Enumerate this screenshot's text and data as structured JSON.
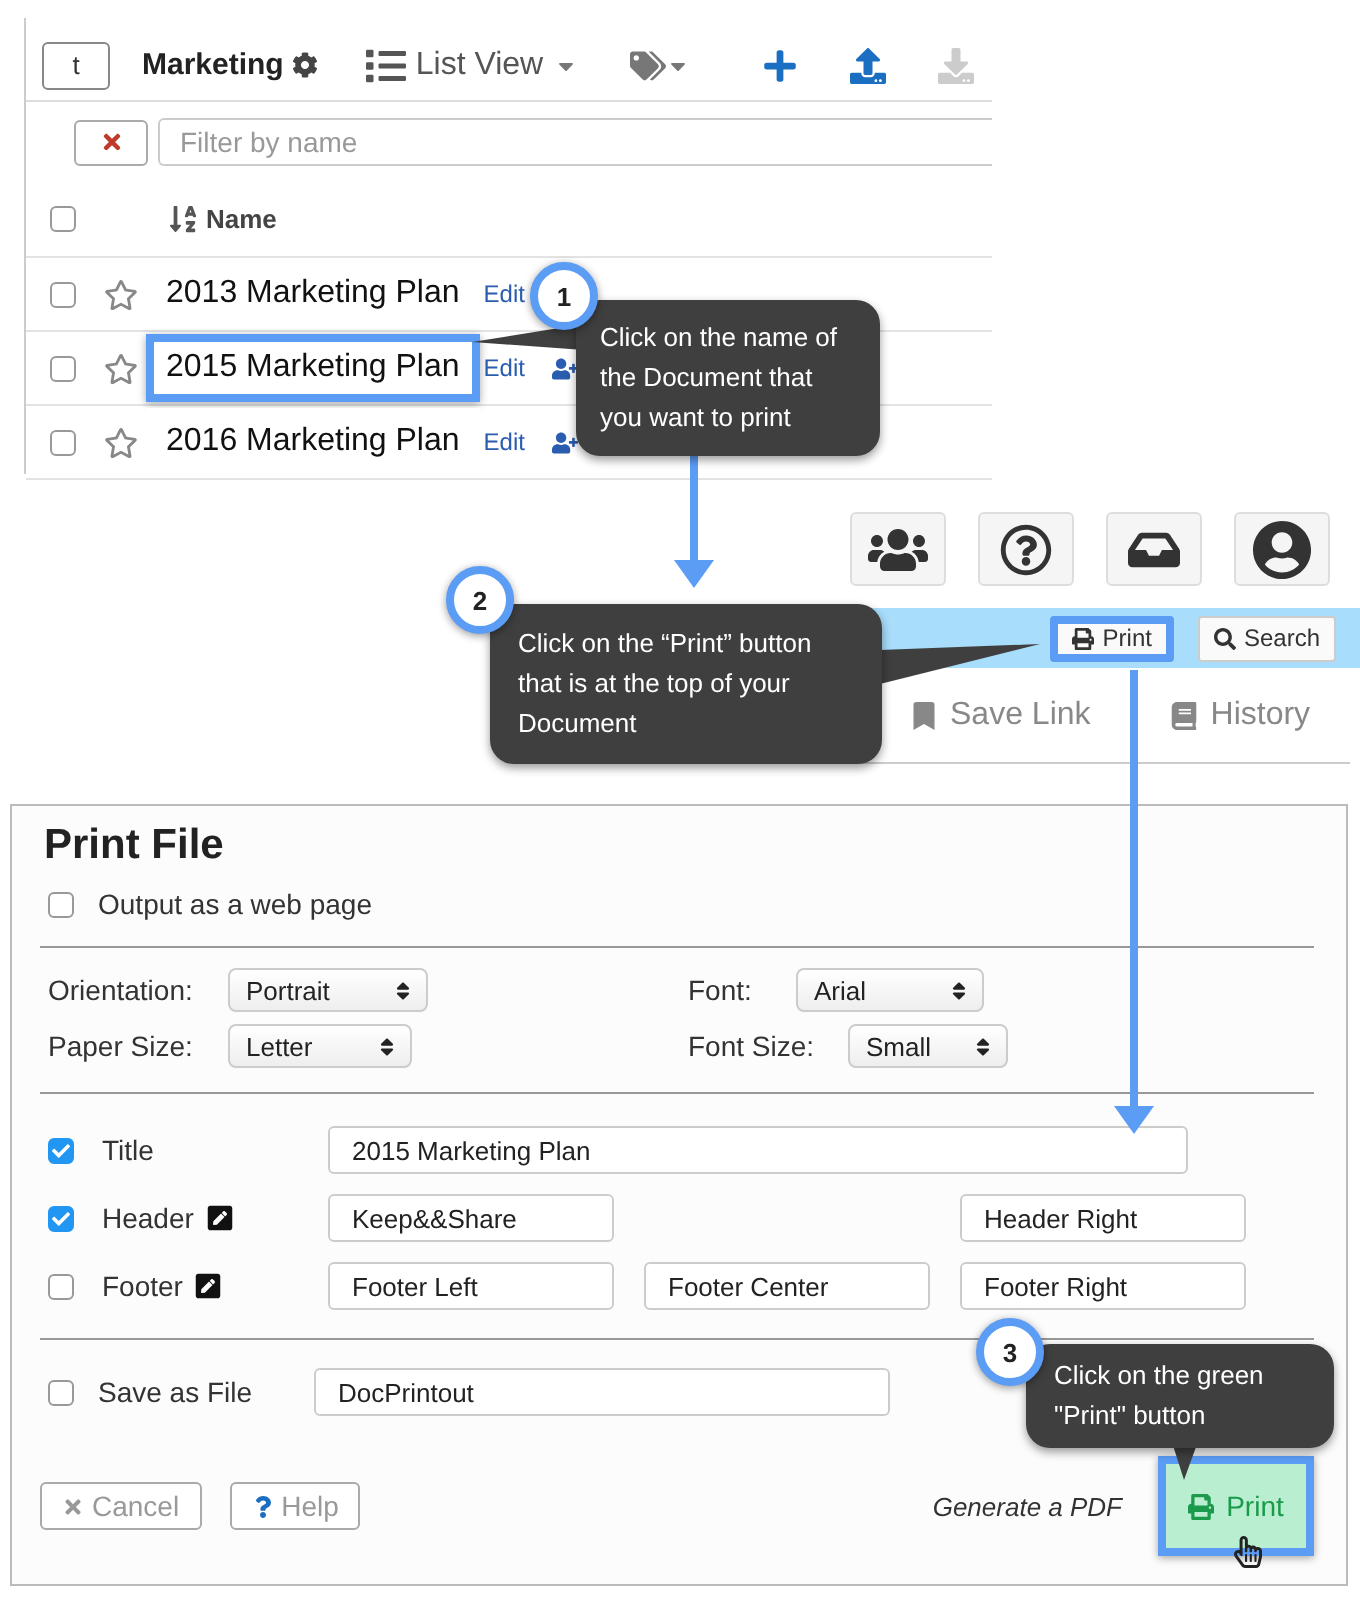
{
  "list_panel": {
    "toolbar": {
      "user_button": "t",
      "folder": "Marketing",
      "view": "List View"
    },
    "filter": {
      "placeholder": "Filter by name"
    },
    "column": "Name",
    "all_checked": false,
    "rows": [
      {
        "name": "2013 Marketing Plan",
        "action": "Edit",
        "checked": false,
        "starred": false,
        "highlighted": false
      },
      {
        "name": "2015 Marketing Plan",
        "action": "Edit",
        "checked": false,
        "starred": false,
        "highlighted": true
      },
      {
        "name": "2016 Marketing Plan",
        "action": "Edit",
        "checked": false,
        "starred": false,
        "highlighted": false
      }
    ]
  },
  "document_bar": {
    "buttons": [
      {
        "label": "Print",
        "kind": "print",
        "highlighted": true
      },
      {
        "label": "Search",
        "kind": "search",
        "highlighted": false
      }
    ],
    "tabs": [
      {
        "label": "Save Link",
        "kind": "bookmark"
      },
      {
        "label": "History",
        "kind": "book"
      }
    ]
  },
  "print_dialog": {
    "title": "Print File",
    "web_page": {
      "label": "Output as a web page",
      "checked": false
    },
    "settings_left": [
      {
        "label": "Orientation:",
        "value": "Portrait"
      },
      {
        "label": "Paper Size:",
        "value": "Letter"
      }
    ],
    "settings_right": [
      {
        "label": "Font:",
        "value": "Arial"
      },
      {
        "label": "Font Size:",
        "value": "Small"
      }
    ],
    "options": [
      {
        "label": "Title",
        "checked": true,
        "editable": false,
        "fields": [
          {
            "value": "2015 Marketing Plan",
            "kind": "wide"
          }
        ]
      },
      {
        "label": "Header",
        "checked": true,
        "editable": true,
        "fields": [
          {
            "value": "Keep&&Share",
            "kind": "left"
          },
          {
            "value": "Header Right",
            "kind": "right"
          }
        ]
      },
      {
        "label": "Footer",
        "checked": false,
        "editable": true,
        "fields": [
          {
            "value": "Footer Left",
            "kind": "left"
          },
          {
            "value": "Footer Center",
            "kind": "center"
          },
          {
            "value": "Footer Right",
            "kind": "right"
          }
        ]
      }
    ],
    "save_file": {
      "label": "Save as File",
      "checked": false,
      "value": "DocPrintout"
    },
    "buttons": [
      {
        "label": "Cancel",
        "kind": "cancel"
      },
      {
        "label": "Help",
        "kind": "help"
      }
    ],
    "hint": "Generate a PDF",
    "print_button": {
      "label": "Print",
      "highlighted": true
    }
  },
  "callouts": [
    {
      "number": "1",
      "text": "Click on the name of the Document that you want to print"
    },
    {
      "number": "2",
      "text": "Click on the “Print” button that is at the top of your Document"
    },
    {
      "number": "3",
      "text": "Click on the green \"Print\" button"
    }
  ]
}
